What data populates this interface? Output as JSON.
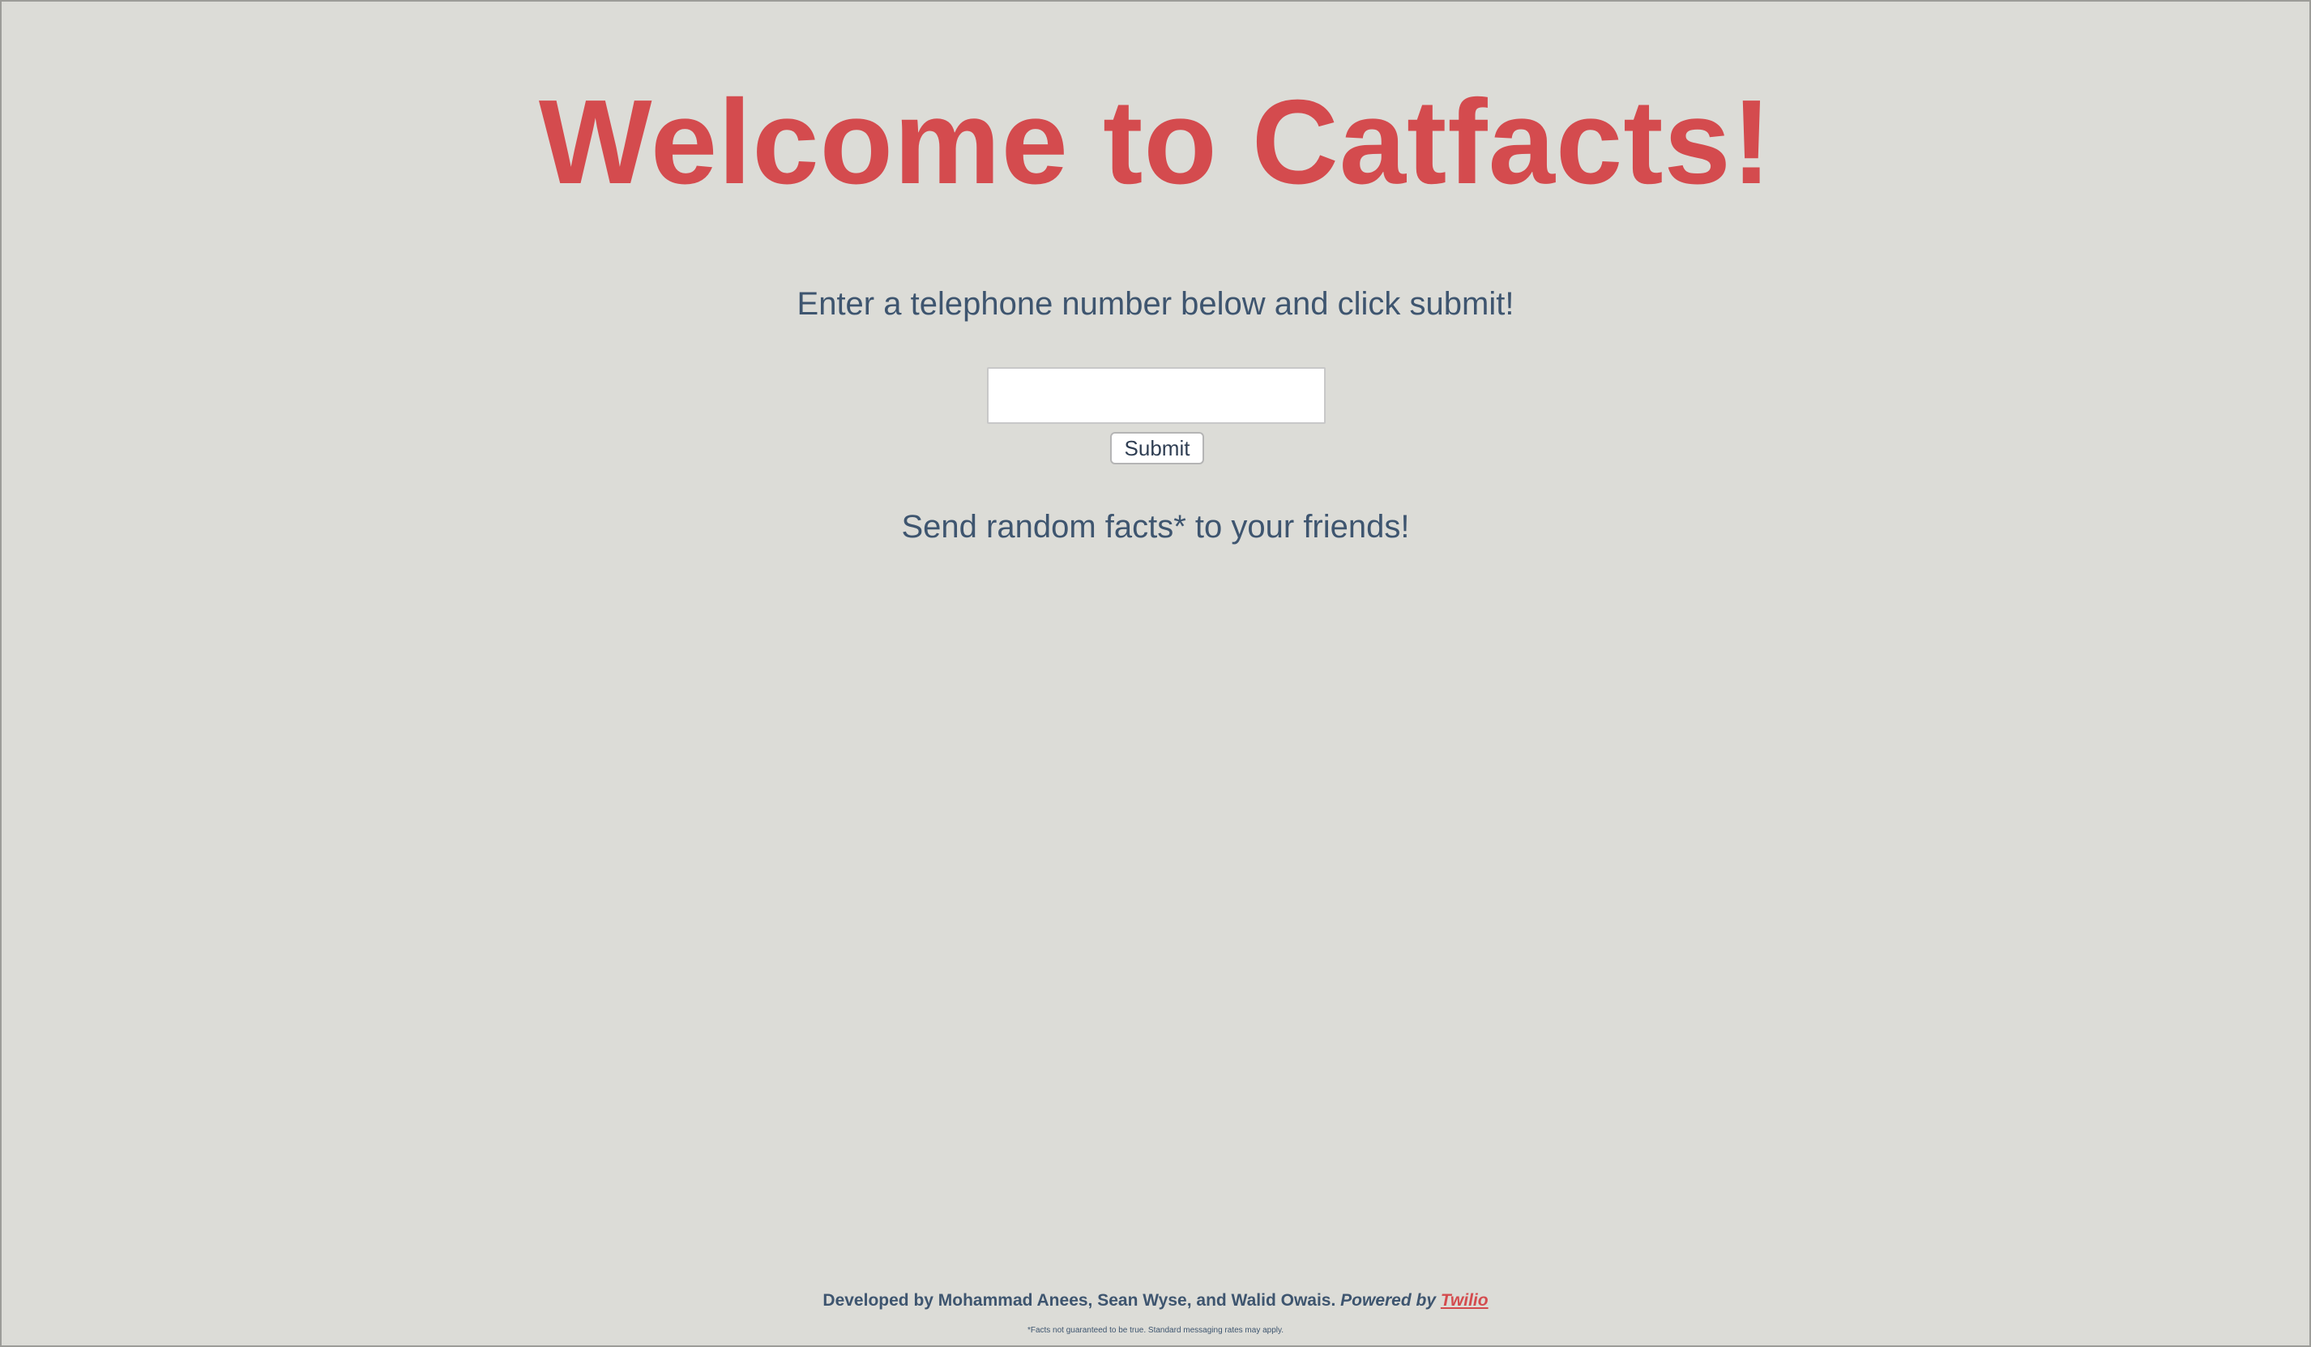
{
  "header": {
    "title": "Welcome to Catfacts!"
  },
  "form": {
    "prompt": "Enter a telephone number below and click submit!",
    "phone_value": "",
    "submit_label": "Submit"
  },
  "tagline": "Send random facts* to your friends!",
  "footer": {
    "credits": "Developed by Mohammad Anees, Sean Wyse, and Walid Owais.",
    "powered_by": "Powered by",
    "link_label": "Twilio",
    "disclaimer": "*Facts not guaranteed to be true. Standard messaging rates may apply."
  },
  "colors": {
    "background": "#dcdcd7",
    "title": "#d44b4e",
    "text": "#3e556f"
  }
}
